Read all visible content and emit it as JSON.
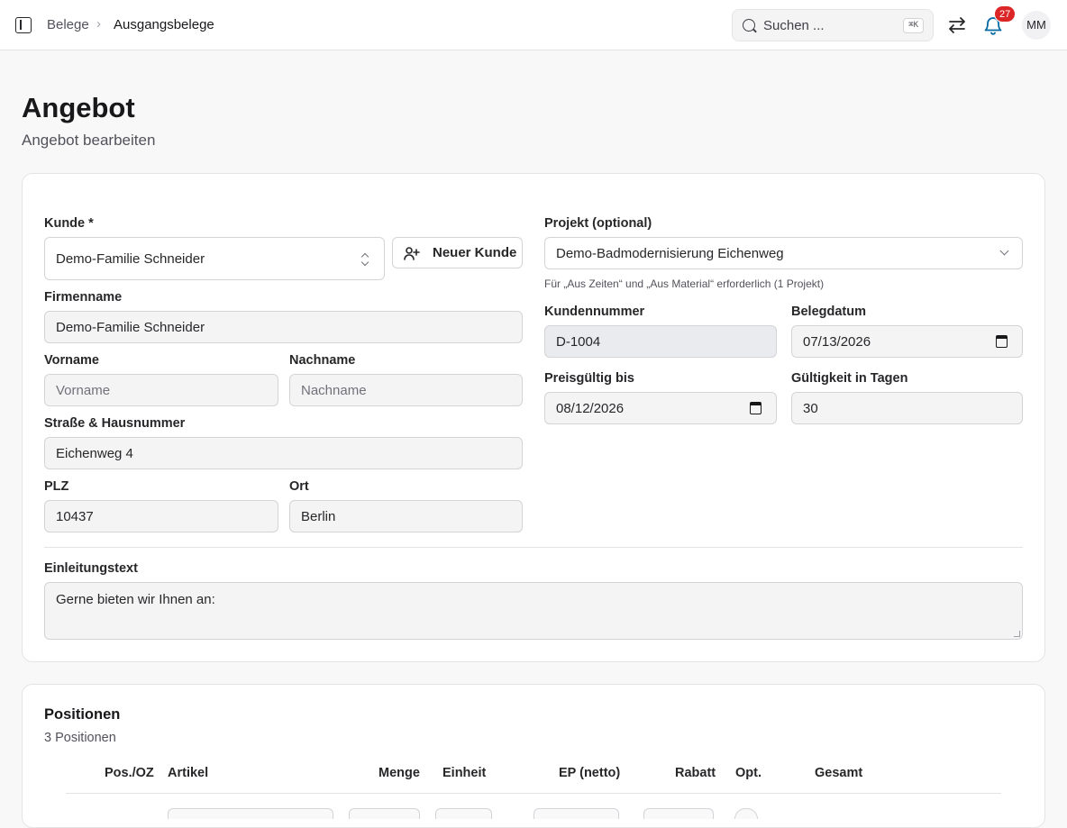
{
  "header": {
    "breadcrumb": [
      "Belege",
      "Ausgangsbelege"
    ],
    "breadcrumb_separator": "›",
    "search_placeholder": "Suchen ...",
    "search_shortcut": "⌘K",
    "notification_count": "27",
    "user_initials": "MM"
  },
  "page": {
    "title": "Angebot",
    "subtitle": "Angebot bearbeiten"
  },
  "form": {
    "kunde": {
      "label": "Kunde *",
      "value": "Demo-Familie Schneider"
    },
    "neuer_kunde_button": "Neuer Kunde",
    "firmenname": {
      "label": "Firmenname",
      "value": "Demo-Familie Schneider"
    },
    "vorname": {
      "label": "Vorname",
      "placeholder": "Vorname"
    },
    "nachname": {
      "label": "Nachname",
      "placeholder": "Nachname"
    },
    "strasse": {
      "label": "Straße & Hausnummer",
      "value": "Eichenweg 4"
    },
    "plz": {
      "label": "PLZ",
      "value": "10437"
    },
    "ort": {
      "label": "Ort",
      "value": "Berlin"
    },
    "projekt": {
      "label": "Projekt (optional)",
      "value": "Demo-Badmodernisierung Eichenweg",
      "hint": "Für „Aus Zeiten“ und „Aus Material“ erforderlich (1 Projekt)"
    },
    "kundennummer": {
      "label": "Kundennummer",
      "value": "D-1004"
    },
    "belegdatum": {
      "label": "Belegdatum",
      "value": "07/13/2026"
    },
    "preisgueltig": {
      "label": "Preisgültig bis",
      "value": "08/12/2026"
    },
    "gueltigkeit": {
      "label": "Gültigkeit in Tagen",
      "value": "30"
    },
    "einleitung": {
      "label": "Einleitungstext",
      "value": "Gerne bieten wir Ihnen an:"
    }
  },
  "positions": {
    "title": "Positionen",
    "count_text": "3 Positionen",
    "columns": [
      "Pos./OZ",
      "Artikel",
      "Menge",
      "Einheit",
      "EP (netto)",
      "Rabatt",
      "Opt.",
      "Gesamt"
    ]
  },
  "icons": [
    "sidebar-toggle-icon",
    "search-icon",
    "swap-icon",
    "bell-icon",
    "user-plus-icon",
    "chevron-updown-icon",
    "chevron-down-icon",
    "calendar-icon"
  ],
  "colors": {
    "badge": "#dc2626",
    "accent": "#0369a1"
  }
}
